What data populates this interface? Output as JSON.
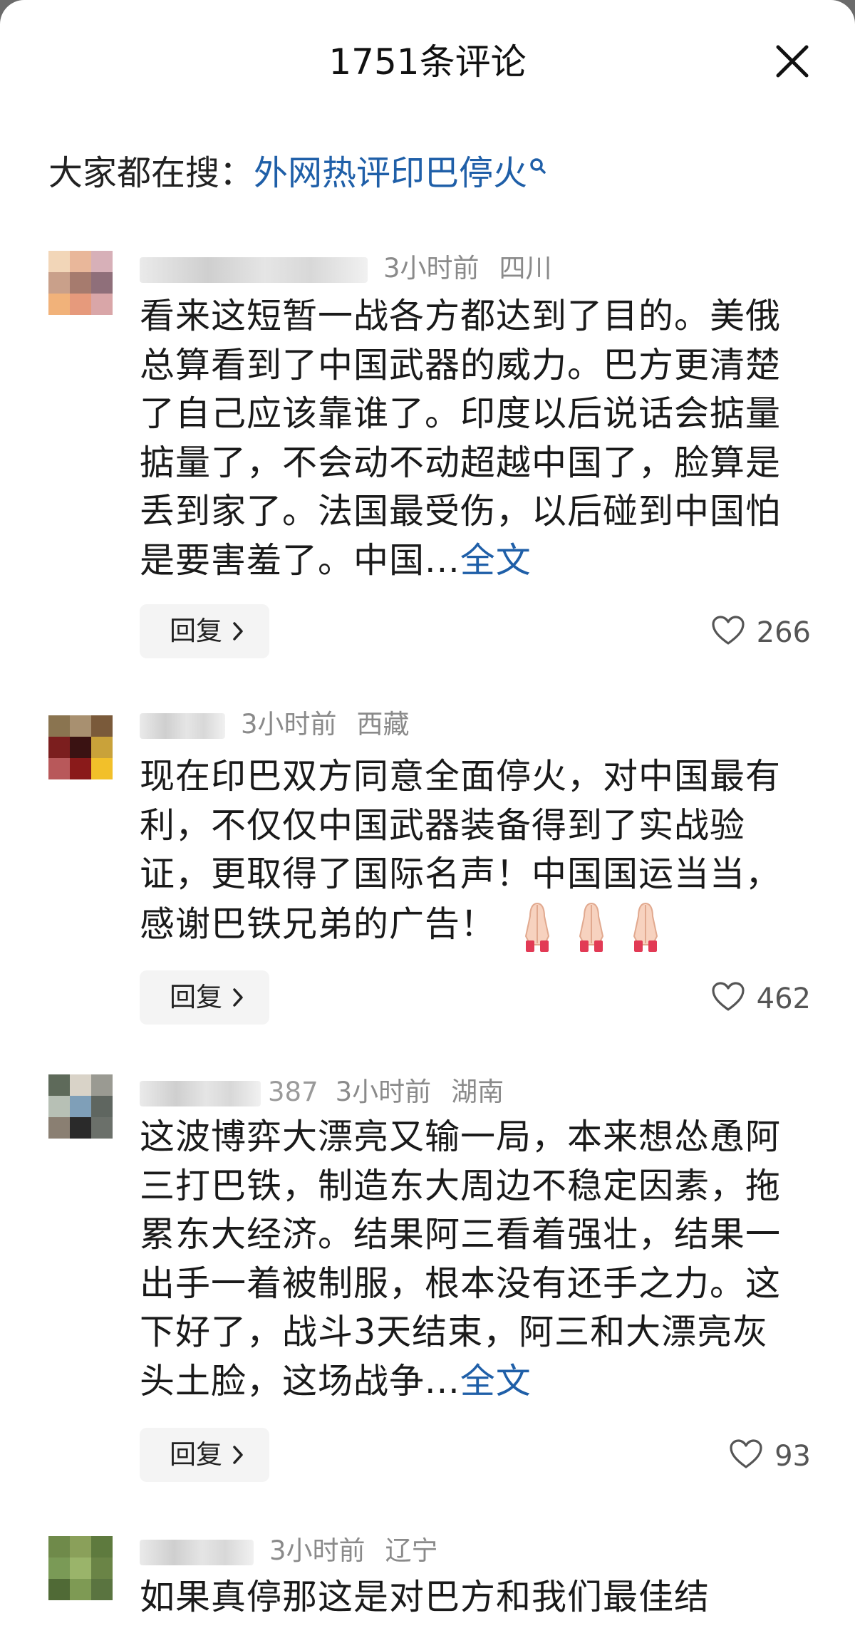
{
  "header": {
    "title": "1751条评论"
  },
  "search": {
    "prefix": "大家都在搜：",
    "term": "外网热评印巴停火"
  },
  "actions": {
    "reply_label": "回复",
    "more_label": "全文"
  },
  "comments": [
    {
      "name_suffix": "",
      "time": "3小时前",
      "location": "四川",
      "text": "看来这短暂一战各方都达到了目的。美俄总算看到了中国武器的威力。巴方更清楚了自己应该靠谁了。印度以后说话会掂量掂量了，不会动不动超越中国了，脸算是丢到家了。法国最受伤，以后碰到中国怕是要害羞了。中国...",
      "likes": "266",
      "avatar_colors": [
        "#f2d6b8",
        "#e9b79a",
        "#d7b0b8",
        "#c9a08a",
        "#a67b6e",
        "#8f6f7a",
        "#f1b27a",
        "#e69a7c",
        "#d9a6a8"
      ]
    },
    {
      "name_suffix": "",
      "time": "3小时前",
      "location": "西藏",
      "text": "现在印巴双方同意全面停火，对中国最有利，不仅仅中国武器装备得到了实战验证，更取得了国际名声！中国国运当当，感谢巴铁兄弟的广告！",
      "emoji": "🙏🙏🙏",
      "likes": "462",
      "avatar_colors": [
        "#8a7450",
        "#a89070",
        "#7a5a3a",
        "#7b1e1e",
        "#3a1212",
        "#c9a23a",
        "#b8585a",
        "#8a1a1a",
        "#f2c02a"
      ]
    },
    {
      "name_suffix": "387",
      "time": "3小时前",
      "location": "湖南",
      "text": "这波博弈大漂亮又输一局，本来想怂恿阿三打巴铁，制造东大周边不稳定因素，拖累东大经济。结果阿三看着强壮，结果一出手一着被制服，根本没有还手之力。这下好了，战斗3天结束，阿三和大漂亮灰头土脸，这场战争...",
      "likes": "93",
      "avatar_colors": [
        "#5e6a5a",
        "#d9d3c8",
        "#9a9a92",
        "#b7c0b5",
        "#7f9fb8",
        "#5f6660",
        "#8a7f72",
        "#2a2a2a",
        "#6b706a"
      ]
    },
    {
      "name_suffix": "",
      "time": "3小时前",
      "location": "辽宁",
      "text": "如果真停那这是对巴方和我们最佳结",
      "likes": "",
      "avatar_colors": [
        "#6f8a4a",
        "#8aa05a",
        "#5e7a3e",
        "#7a9a56",
        "#9ab46a",
        "#6a8446",
        "#506a36",
        "#7e9a54",
        "#5a7440"
      ]
    }
  ],
  "colors": {
    "link": "#1f5fa8",
    "meta": "#8a8a8a",
    "text": "#1a1a1a",
    "reply_bg": "#f4f4f4"
  },
  "icons": {
    "close": "close-icon",
    "search": "search-icon",
    "heart": "heart-icon",
    "chevron": "chevron-right-icon"
  }
}
